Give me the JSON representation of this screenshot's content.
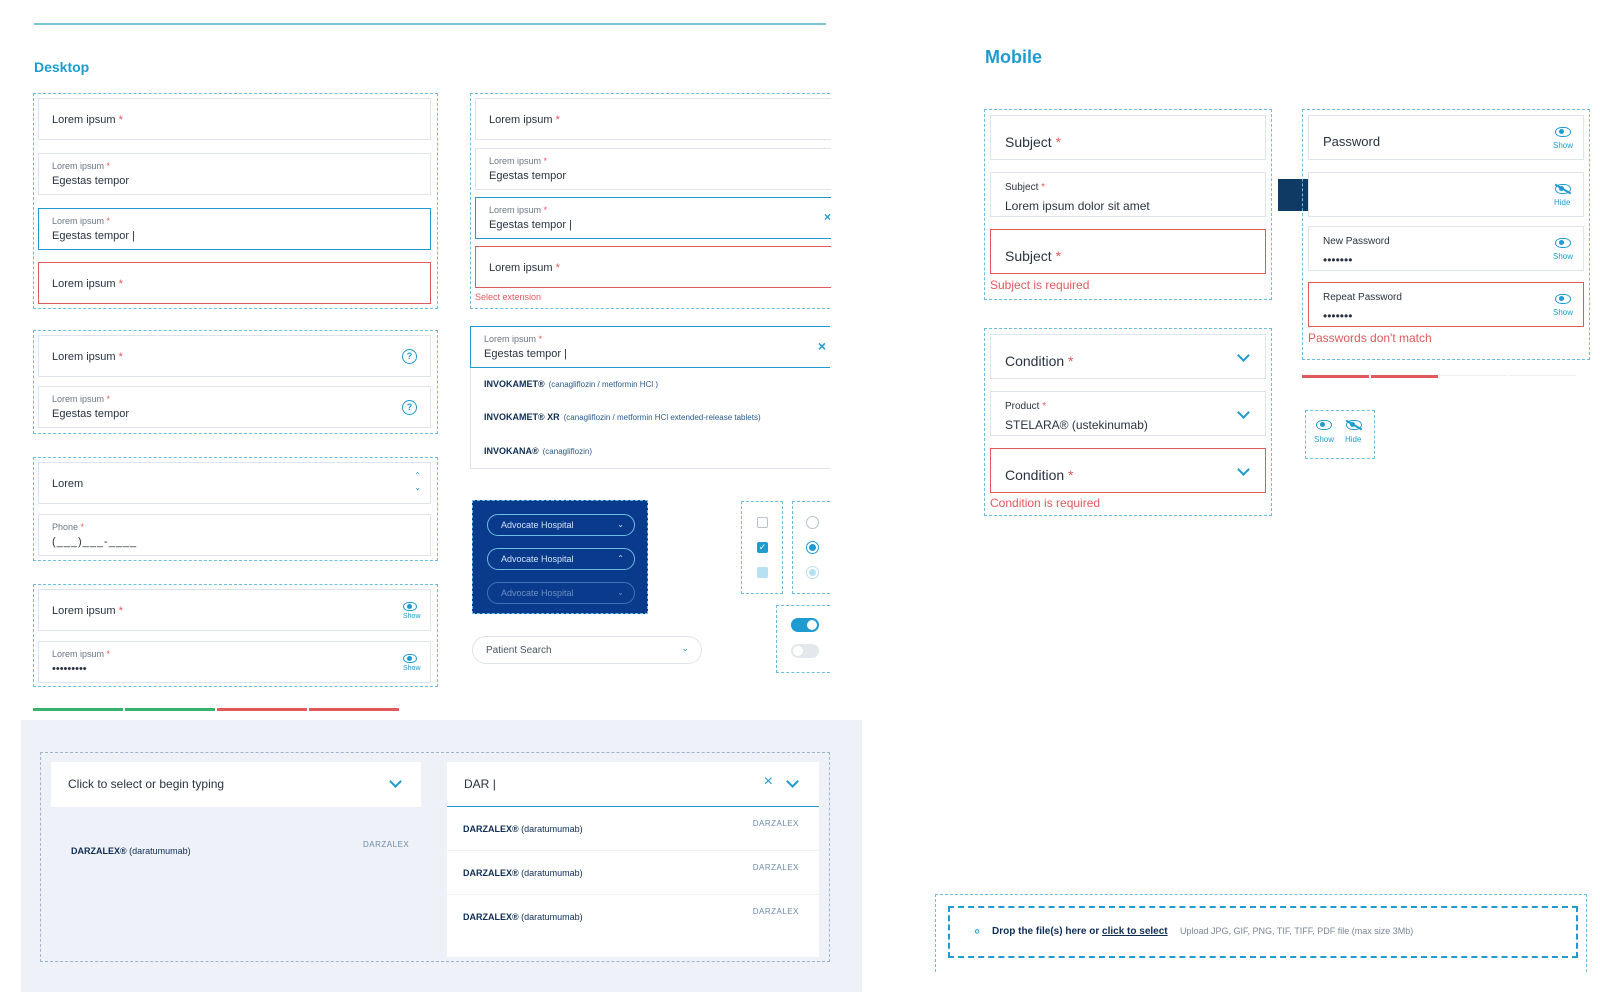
{
  "desktop": {
    "title": "Desktop",
    "col1": {
      "g1": {
        "f1_label": "Lorem ipsum",
        "f2_label": "Lorem ipsum",
        "f2_value": "Egestas tempor",
        "f3_label": "Lorem ipsum",
        "f3_value": "Egestas tempor",
        "f4_label": "Lorem ipsum"
      },
      "g2": {
        "f1_label": "Lorem ipsum",
        "f2_label": "Lorem ipsum",
        "f2_value": "Egestas tempor",
        "help_icon": "question-circle-icon"
      },
      "g3": {
        "f1_value": "Lorem",
        "phone_label": "Phone",
        "phone_mask": "(___)___-____"
      },
      "g4": {
        "f1_label": "Lorem ipsum",
        "f2_label": "Lorem ipsum",
        "f2_value": "•••••••••",
        "show_label": "Show"
      }
    },
    "col2": {
      "g1": {
        "f1_label": "Lorem ipsum",
        "f2_label": "Lorem ipsum",
        "f2_value": "Egestas tempor",
        "f3_label": "Lorem ipsum",
        "f3_value": "Egestas tempor",
        "f4_label": "Lorem ipsum",
        "error": "Select extension"
      },
      "autocomplete": {
        "label": "Lorem ipsum",
        "value": "Egestas tempor",
        "items": [
          {
            "name": "INVOKAMET®",
            "sub": "(canagliflozin / metformin HCl )"
          },
          {
            "name": "INVOKAMET® XR",
            "sub": "(canagliflozin / metformin HCl extended-release tablets)"
          },
          {
            "name": "INVOKANA®",
            "sub": "(canagliflozin)"
          }
        ]
      },
      "dark_selects": [
        "Advocate Hospital",
        "Advocate Hospital",
        "Advocate Hospital"
      ],
      "patient_search": "Patient Search"
    },
    "bottom": {
      "select_placeholder": "Click to select or begin typing",
      "select_item": {
        "name": "DARZALEX®",
        "sub": "(daratumumab)"
      },
      "search_value": "DAR",
      "results": [
        {
          "name": "DARZALEX®",
          "sub": "(daratumumab)"
        },
        {
          "name": "DARZALEX®",
          "sub": "(daratumumab)"
        },
        {
          "name": "DARZALEX®",
          "sub": "(daratumumab)"
        }
      ],
      "logo_text": "DARZALEX"
    }
  },
  "mobile": {
    "title": "Mobile",
    "subject": {
      "f1_label": "Subject",
      "f2_label": "Subject",
      "f2_value": "Lorem ipsum dolor sit amet",
      "f3_label": "Subject",
      "error": "Subject is required"
    },
    "condition": {
      "f1_label": "Condition",
      "f2_label": "Product",
      "f2_value": "STELARA® (ustekinumab)",
      "f3_label": "Condition",
      "error": "Condition is required"
    },
    "password": {
      "f1_label": "Password",
      "show": "Show",
      "hide": "Hide",
      "f3_label": "New Password",
      "f3_value": "•••••••",
      "f4_label": "Repeat Password",
      "f4_value": "•••••••",
      "error": "Passwords don't match"
    },
    "eye_legend": {
      "show": "Show",
      "hide": "Hide"
    },
    "upload": {
      "drop_text": "Drop the file(s) here or ",
      "link": "click to select",
      "hint": "Upload JPG, GIF, PNG, TIF, TIFF, PDF file (max size 3Mb)"
    }
  },
  "colors": {
    "accent": "#1e9bd0",
    "error": "#e3585c",
    "navy": "#0a3a8c",
    "success": "#36b36a"
  },
  "strength_meters": {
    "desktop_filled": 4,
    "mobile_filled": 2
  }
}
